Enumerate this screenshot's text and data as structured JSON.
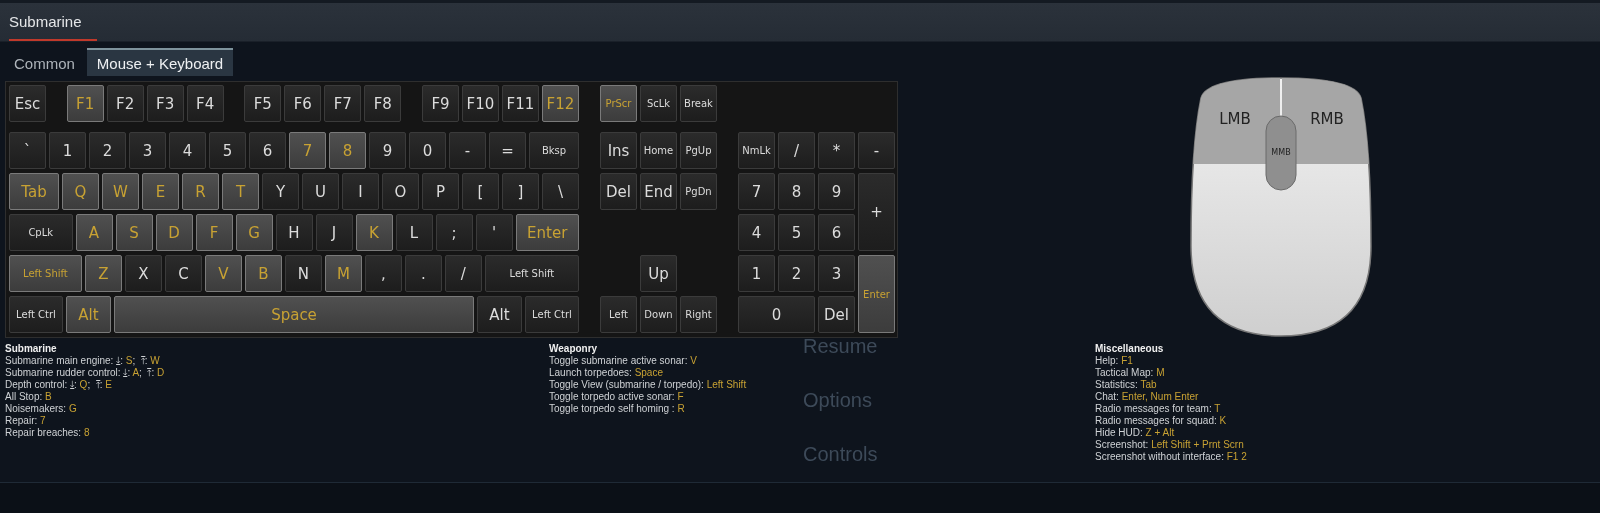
{
  "window": {
    "title": "Submarine"
  },
  "tabs": [
    {
      "label": "Common",
      "selected": false
    },
    {
      "label": "Mouse + Keyboard",
      "selected": true
    }
  ],
  "background_menu": [
    "Resume",
    "Options",
    "Controls"
  ],
  "keyboard": {
    "function_groups": [
      [
        {
          "label": "Esc",
          "bound": false
        }
      ],
      [
        {
          "label": "F1",
          "bound": true
        },
        {
          "label": "F2",
          "bound": false
        },
        {
          "label": "F3",
          "bound": false
        },
        {
          "label": "F4",
          "bound": false
        }
      ],
      [
        {
          "label": "F5",
          "bound": false
        },
        {
          "label": "F6",
          "bound": false
        },
        {
          "label": "F7",
          "bound": false
        },
        {
          "label": "F8",
          "bound": false
        }
      ],
      [
        {
          "label": "F9",
          "bound": false
        },
        {
          "label": "F10",
          "bound": false
        },
        {
          "label": "F11",
          "bound": false
        },
        {
          "label": "F12",
          "bound": true
        }
      ]
    ],
    "main_rows": [
      [
        {
          "label": "`",
          "kind": "std",
          "bound": false
        },
        {
          "label": "1",
          "kind": "std",
          "bound": false
        },
        {
          "label": "2",
          "kind": "std",
          "bound": false
        },
        {
          "label": "3",
          "kind": "std",
          "bound": false
        },
        {
          "label": "4",
          "kind": "std",
          "bound": false
        },
        {
          "label": "5",
          "kind": "std",
          "bound": false
        },
        {
          "label": "6",
          "kind": "std",
          "bound": false
        },
        {
          "label": "7",
          "kind": "std",
          "bound": true
        },
        {
          "label": "8",
          "kind": "std",
          "bound": true
        },
        {
          "label": "9",
          "kind": "std",
          "bound": false
        },
        {
          "label": "0",
          "kind": "std",
          "bound": false
        },
        {
          "label": "-",
          "kind": "std",
          "bound": false
        },
        {
          "label": "=",
          "kind": "std",
          "bound": false
        },
        {
          "label": "Bksp",
          "kind": "wide",
          "bound": false
        }
      ],
      [
        {
          "label": "Tab",
          "kind": "wide",
          "bound": true
        },
        {
          "label": "Q",
          "kind": "std",
          "bound": true
        },
        {
          "label": "W",
          "kind": "std",
          "bound": true
        },
        {
          "label": "E",
          "kind": "std",
          "bound": true
        },
        {
          "label": "R",
          "kind": "std",
          "bound": true
        },
        {
          "label": "T",
          "kind": "std",
          "bound": true
        },
        {
          "label": "Y",
          "kind": "std",
          "bound": false
        },
        {
          "label": "U",
          "kind": "std",
          "bound": false
        },
        {
          "label": "I",
          "kind": "std",
          "bound": false
        },
        {
          "label": "O",
          "kind": "std",
          "bound": false
        },
        {
          "label": "P",
          "kind": "std",
          "bound": false
        },
        {
          "label": "[",
          "kind": "std",
          "bound": false
        },
        {
          "label": "]",
          "kind": "std",
          "bound": false
        },
        {
          "label": "\\",
          "kind": "std",
          "bound": false
        }
      ],
      [
        {
          "label": "CpLk",
          "kind": "wide",
          "bound": false
        },
        {
          "label": "A",
          "kind": "std",
          "bound": true
        },
        {
          "label": "S",
          "kind": "std",
          "bound": true
        },
        {
          "label": "D",
          "kind": "std",
          "bound": true
        },
        {
          "label": "F",
          "kind": "std",
          "bound": true
        },
        {
          "label": "G",
          "kind": "std",
          "bound": true
        },
        {
          "label": "H",
          "kind": "std",
          "bound": false
        },
        {
          "label": "J",
          "kind": "std",
          "bound": false
        },
        {
          "label": "K",
          "kind": "std",
          "bound": true
        },
        {
          "label": "L",
          "kind": "std",
          "bound": false
        },
        {
          "label": ";",
          "kind": "std",
          "bound": false
        },
        {
          "label": "'",
          "kind": "std",
          "bound": false
        },
        {
          "label": "Enter",
          "kind": "wide-big",
          "bound": true
        }
      ],
      [
        {
          "label": "Left Shift",
          "kind": "wide",
          "bound": true
        },
        {
          "label": "Z",
          "kind": "std",
          "bound": true
        },
        {
          "label": "X",
          "kind": "std",
          "bound": false
        },
        {
          "label": "C",
          "kind": "std",
          "bound": false
        },
        {
          "label": "V",
          "kind": "std",
          "bound": true
        },
        {
          "label": "B",
          "kind": "std",
          "bound": true
        },
        {
          "label": "N",
          "kind": "std",
          "bound": false
        },
        {
          "label": "M",
          "kind": "std",
          "bound": true
        },
        {
          "label": ",",
          "kind": "std",
          "bound": false
        },
        {
          "label": ".",
          "kind": "std",
          "bound": false
        },
        {
          "label": "/",
          "kind": "std",
          "bound": false
        },
        {
          "label": "Left Shift",
          "kind": "wider",
          "bound": false
        }
      ],
      [
        {
          "label": "Left Ctrl",
          "kind": "ctrl",
          "bound": false
        },
        {
          "label": "Alt",
          "kind": "alt",
          "bound": true
        },
        {
          "label": "Space",
          "kind": "space",
          "bound": true
        },
        {
          "label": "Alt",
          "kind": "alt",
          "bound": false
        },
        {
          "label": "Left Ctrl",
          "kind": "ctrl",
          "bound": false
        }
      ]
    ],
    "system_keys": [
      {
        "label": "PrScr",
        "bound": true
      },
      {
        "label": "ScLk",
        "bound": false
      },
      {
        "label": "Break",
        "bound": false
      }
    ],
    "nav_rows": [
      [
        {
          "label": "Ins",
          "bound": false
        },
        {
          "label": "Home",
          "bound": false
        },
        {
          "label": "PgUp",
          "bound": false
        }
      ],
      [
        {
          "label": "Del",
          "bound": false
        },
        {
          "label": "End",
          "bound": false
        },
        {
          "label": "PgDn",
          "bound": false
        }
      ]
    ],
    "arrow_rows": [
      [
        {
          "label": "Up",
          "bound": false
        }
      ],
      [
        {
          "label": "Left",
          "bound": false
        },
        {
          "label": "Down",
          "bound": false
        },
        {
          "label": "Right",
          "bound": false
        }
      ]
    ],
    "numpad": [
      {
        "label": "NmLk",
        "kind": "std",
        "bound": false
      },
      {
        "label": "/",
        "kind": "std",
        "bound": false
      },
      {
        "label": "*",
        "kind": "std",
        "bound": false
      },
      {
        "label": "-",
        "kind": "std",
        "bound": false
      },
      {
        "label": "7",
        "kind": "std",
        "bound": false
      },
      {
        "label": "8",
        "kind": "std",
        "bound": false
      },
      {
        "label": "9",
        "kind": "std",
        "bound": false
      },
      {
        "label": "+",
        "kind": "tall",
        "bound": false
      },
      {
        "label": "4",
        "kind": "std",
        "bound": false
      },
      {
        "label": "5",
        "kind": "std",
        "bound": false
      },
      {
        "label": "6",
        "kind": "std",
        "bound": false
      },
      {
        "label": "1",
        "kind": "std",
        "bound": false
      },
      {
        "label": "2",
        "kind": "std",
        "bound": false
      },
      {
        "label": "3",
        "kind": "std",
        "bound": false
      },
      {
        "label": "Enter",
        "kind": "tall",
        "bound": true
      },
      {
        "label": "0",
        "kind": "wide",
        "bound": false
      },
      {
        "label": "Del",
        "kind": "std",
        "bound": false
      }
    ]
  },
  "mouse": {
    "left": "LMB",
    "right": "RMB",
    "middle": "MMB"
  },
  "sections": [
    {
      "title": "Submarine",
      "lines": [
        [
          {
            "text": "Submarine main engine: ⤓: ",
            "kind": "label"
          },
          {
            "text": "S",
            "kind": "key"
          },
          {
            "text": ";  ⤒: ",
            "kind": "label"
          },
          {
            "text": "W",
            "kind": "key"
          }
        ],
        [
          {
            "text": "Submarine rudder control: ⤓: ",
            "kind": "label"
          },
          {
            "text": "A",
            "kind": "key"
          },
          {
            "text": ";  ⤒: ",
            "kind": "label"
          },
          {
            "text": "D",
            "kind": "key"
          }
        ],
        [
          {
            "text": "Depth control: ⤓: ",
            "kind": "label"
          },
          {
            "text": "Q",
            "kind": "key"
          },
          {
            "text": ";  ⤒: ",
            "kind": "label"
          },
          {
            "text": "E",
            "kind": "key"
          }
        ],
        [
          {
            "text": "All Stop: ",
            "kind": "label"
          },
          {
            "text": "B",
            "kind": "key"
          }
        ],
        [
          {
            "text": "Noisemakers: ",
            "kind": "label"
          },
          {
            "text": "G",
            "kind": "key"
          }
        ],
        [
          {
            "text": "Repair: ",
            "kind": "label"
          },
          {
            "text": "7",
            "kind": "key"
          }
        ],
        [
          {
            "text": "Repair breaches: ",
            "kind": "label"
          },
          {
            "text": "8",
            "kind": "key"
          }
        ]
      ]
    },
    {
      "title": "Weaponry",
      "lines": [
        [
          {
            "text": "Toggle submarine active sonar: ",
            "kind": "label"
          },
          {
            "text": "V",
            "kind": "key"
          }
        ],
        [
          {
            "text": "Launch torpedoes: ",
            "kind": "label"
          },
          {
            "text": "Space",
            "kind": "key"
          }
        ],
        [
          {
            "text": "Toggle View (submarine / torpedo): ",
            "kind": "label"
          },
          {
            "text": "Left Shift",
            "kind": "key"
          }
        ],
        [
          {
            "text": "Toggle torpedo active sonar: ",
            "kind": "label"
          },
          {
            "text": "F",
            "kind": "key"
          }
        ],
        [
          {
            "text": "Toggle torpedo self homing : ",
            "kind": "label"
          },
          {
            "text": "R",
            "kind": "key"
          }
        ]
      ]
    },
    {
      "title": "Miscellaneous",
      "lines": [
        [
          {
            "text": "Help: ",
            "kind": "label"
          },
          {
            "text": "F1",
            "kind": "key"
          }
        ],
        [
          {
            "text": "Tactical Map: ",
            "kind": "label"
          },
          {
            "text": "M",
            "kind": "key"
          }
        ],
        [
          {
            "text": "Statistics: ",
            "kind": "label"
          },
          {
            "text": "Tab",
            "kind": "key"
          }
        ],
        [
          {
            "text": "Chat: ",
            "kind": "label"
          },
          {
            "text": "Enter, Num Enter",
            "kind": "key"
          }
        ],
        [
          {
            "text": "Radio messages for team: ",
            "kind": "label"
          },
          {
            "text": "T",
            "kind": "key"
          }
        ],
        [
          {
            "text": "Radio messages for squad: ",
            "kind": "label"
          },
          {
            "text": "K",
            "kind": "key"
          }
        ],
        [
          {
            "text": "Hide HUD: ",
            "kind": "label"
          },
          {
            "text": "Z + Alt",
            "kind": "key"
          }
        ],
        [
          {
            "text": "Screenshot: ",
            "kind": "label"
          },
          {
            "text": "Left Shift + Prnt Scrn",
            "kind": "key"
          }
        ],
        [
          {
            "text": "Screenshot without interface: ",
            "kind": "label"
          },
          {
            "text": "F1 2",
            "kind": "key"
          }
        ]
      ]
    }
  ]
}
